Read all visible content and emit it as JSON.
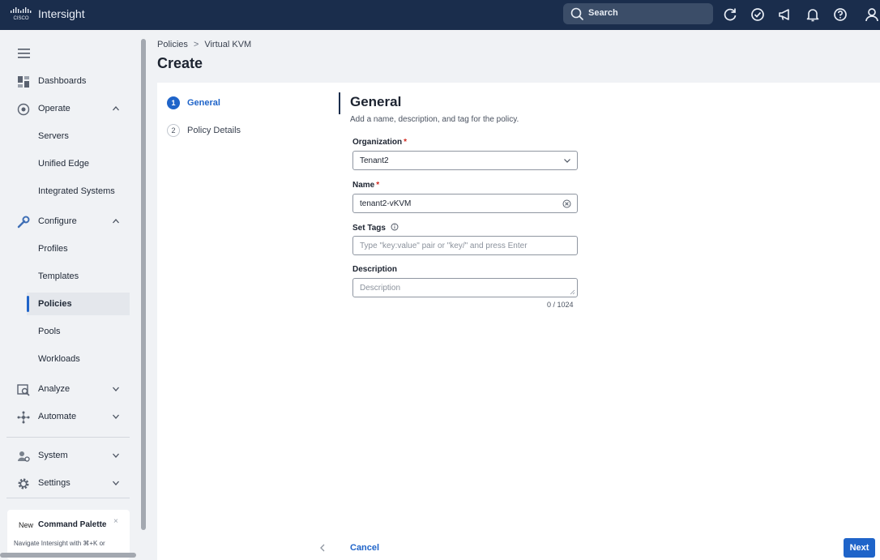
{
  "header": {
    "app_title": "Intersight",
    "search_label": "Search",
    "icons": [
      "cisco-logo",
      "search-icon",
      "refresh-icon",
      "tasks-icon",
      "announcement-icon",
      "bell-icon",
      "help-icon",
      "user-icon"
    ]
  },
  "sidebar": {
    "items": [
      {
        "label": "Dashboards",
        "icon": "dashboard-icon"
      },
      {
        "label": "Operate",
        "icon": "operate-icon",
        "expanded": true
      },
      {
        "label": "Servers"
      },
      {
        "label": "Unified Edge"
      },
      {
        "label": "Integrated Systems"
      },
      {
        "label": "Configure",
        "icon": "configure-icon",
        "expanded": true
      },
      {
        "label": "Profiles"
      },
      {
        "label": "Templates"
      },
      {
        "label": "Policies",
        "active": true
      },
      {
        "label": "Pools"
      },
      {
        "label": "Workloads"
      },
      {
        "label": "Analyze",
        "icon": "analyze-icon",
        "expanded": false
      },
      {
        "label": "Automate",
        "icon": "automate-icon",
        "expanded": false
      },
      {
        "label": "System",
        "icon": "system-icon",
        "expanded": false
      },
      {
        "label": "Settings",
        "icon": "settings-icon",
        "expanded": false
      }
    ],
    "command_palette": {
      "badge": "New",
      "title": "Command Palette",
      "close": "×",
      "description": "Navigate Intersight with ⌘+K or"
    }
  },
  "breadcrumb": {
    "items": [
      "Policies",
      "Virtual KVM"
    ],
    "separator": ">"
  },
  "page_title": "Create",
  "wizard": {
    "steps": [
      {
        "number": "1",
        "label": "General",
        "active": true
      },
      {
        "number": "2",
        "label": "Policy Details",
        "active": false
      }
    ]
  },
  "general": {
    "title": "General",
    "subtitle": "Add a name, description, and tag for the policy.",
    "organization": {
      "label": "Organization",
      "required": "*",
      "value": "Tenant2"
    },
    "name": {
      "label": "Name",
      "required": "*",
      "value": "tenant2-vKVM"
    },
    "tags": {
      "label": "Set Tags",
      "placeholder": "Type \"key:value\" pair or \"key/\" and press Enter"
    },
    "description": {
      "label": "Description",
      "placeholder": "Description",
      "counter": "0 / 1024"
    }
  },
  "footer": {
    "cancel_label": "Cancel",
    "next_label": "Next"
  },
  "colors": {
    "header_bg": "#1a2d4c",
    "accent": "#1f64c9",
    "required": "#d0271d",
    "sidebar_bg": "#f0f2f5"
  }
}
